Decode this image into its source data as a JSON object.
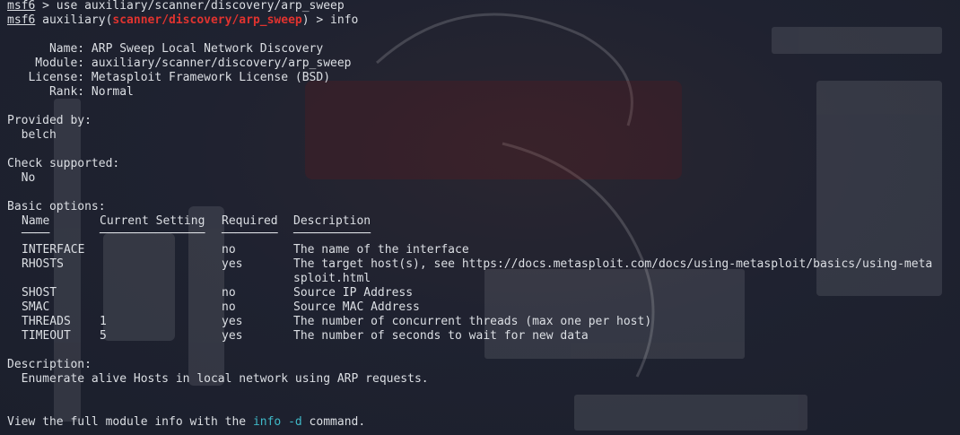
{
  "prompt": {
    "label": "msf6",
    "line1_rest": " > use auxiliary/scanner/discovery/arp_sweep",
    "line2_prefix": " auxiliary(",
    "module_path": "scanner/discovery/arp_sweep",
    "line2_suffix": ") > info"
  },
  "info": [
    {
      "key": "      Name:",
      "value": " ARP Sweep Local Network Discovery"
    },
    {
      "key": "    Module:",
      "value": " auxiliary/scanner/discovery/arp_sweep"
    },
    {
      "key": "   License:",
      "value": " Metasploit Framework License (BSD)"
    },
    {
      "key": "      Rank:",
      "value": " Normal"
    }
  ],
  "provided_by": {
    "heading": "Provided by:",
    "value": "  belch"
  },
  "check_supported": {
    "heading": "Check supported:",
    "value": "  No"
  },
  "basic_options": {
    "heading": "Basic options:",
    "headers": [
      "Name",
      "Current Setting",
      "Required",
      "Description"
    ],
    "underlines": [
      "────",
      "───────────────",
      "────────",
      "───────────"
    ],
    "rows": [
      {
        "name": "INTERFACE",
        "setting": "",
        "required": "no",
        "description": "The name of the interface",
        "description2": ""
      },
      {
        "name": "RHOSTS",
        "setting": "",
        "required": "yes",
        "description": "The target host(s), see https://docs.metasploit.com/docs/using-metasploit/basics/using-meta",
        "description2": "sploit.html"
      },
      {
        "name": "SHOST",
        "setting": "",
        "required": "no",
        "description": "Source IP Address",
        "description2": ""
      },
      {
        "name": "SMAC",
        "setting": "",
        "required": "no",
        "description": "Source MAC Address",
        "description2": ""
      },
      {
        "name": "THREADS",
        "setting": "1",
        "required": "yes",
        "description": "The number of concurrent threads (max one per host)",
        "description2": ""
      },
      {
        "name": "TIMEOUT",
        "setting": "5",
        "required": "yes",
        "description": "The number of seconds to wait for new data",
        "description2": ""
      }
    ]
  },
  "description": {
    "heading": "Description:",
    "value": "  Enumerate alive Hosts in local network using ARP requests."
  },
  "footer": {
    "before": "View the full module info with the ",
    "cmd": "info -d",
    "after": " command."
  },
  "colors": {
    "background": "#1e2230",
    "text": "#dcdfe4",
    "module_highlight": "#e0332f",
    "command_highlight": "#3fb9c8"
  }
}
